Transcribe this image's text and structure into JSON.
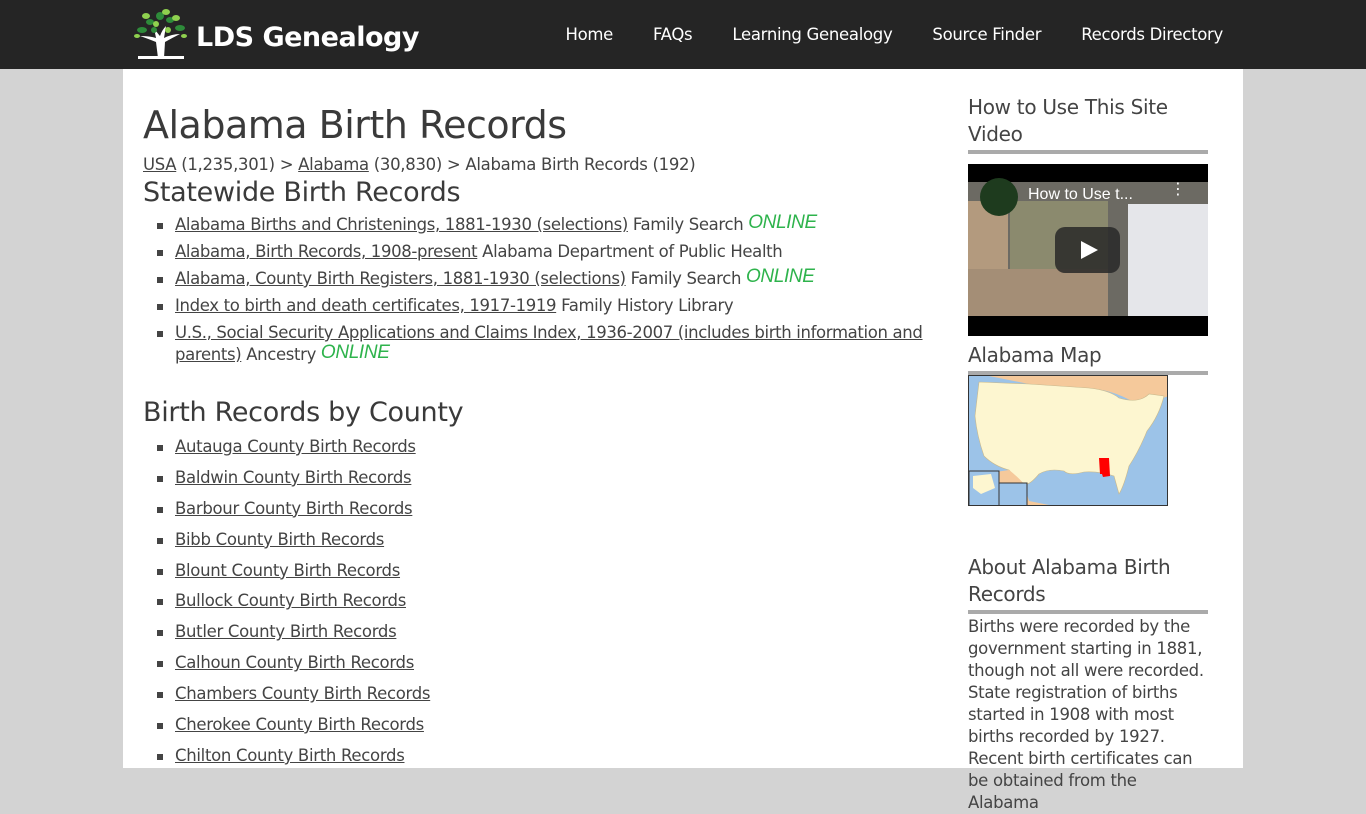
{
  "site": {
    "name": "LDS Genealogy",
    "logo_icon": "tree-icon"
  },
  "nav": [
    {
      "label": "Home"
    },
    {
      "label": "FAQs"
    },
    {
      "label": "Learning Genealogy"
    },
    {
      "label": "Source Finder"
    },
    {
      "label": "Records Directory"
    }
  ],
  "page": {
    "title": "Alabama Birth Records",
    "breadcrumb": {
      "usa_link": "USA",
      "usa_count": " (1,235,301) > ",
      "state_link": "Alabama",
      "state_count": " (30,830) > ",
      "current": "Alabama Birth Records (192)"
    }
  },
  "statewide": {
    "heading": "Statewide Birth Records",
    "items": [
      {
        "link": "Alabama Births and Christenings, 1881-1930 (selections)",
        "source": " Family Search ",
        "badge": "ONLINE"
      },
      {
        "link": "Alabama, Birth Records, 1908-present",
        "source": " Alabama Department of Public Health",
        "badge": ""
      },
      {
        "link": "Alabama, County Birth Registers, 1881-1930 (selections)",
        "source": " Family Search ",
        "badge": "ONLINE"
      },
      {
        "link": "Index to birth and death certificates, 1917-1919",
        "source": " Family History Library",
        "badge": ""
      },
      {
        "link": "U.S., Social Security Applications and Claims Index, 1936-2007 (includes birth information and parents)",
        "source": " Ancestry ",
        "badge": "ONLINE"
      }
    ]
  },
  "county": {
    "heading": "Birth Records by County",
    "items": [
      "Autauga County Birth Records",
      "Baldwin County Birth Records",
      "Barbour County Birth Records",
      "Bibb County Birth Records",
      "Blount County Birth Records",
      "Bullock County Birth Records",
      "Butler County Birth Records",
      "Calhoun County Birth Records",
      "Chambers County Birth Records",
      "Cherokee County Birth Records",
      "Chilton County Birth Records"
    ]
  },
  "sidebar": {
    "video_heading": "How to Use This Site Video",
    "video_title": "How to Use t...",
    "map_heading": "Alabama Map",
    "about_heading": "About Alabama Birth Records",
    "about_text": "Births were recorded by the government starting in 1881, though not all were recorded. State registration of births started in 1908 with most births recorded by 1927. Recent birth certificates can be obtained from the Alabama"
  },
  "colors": {
    "topbar": "#252525",
    "online": "#2eb34c",
    "highlight_state": "#ff0000",
    "background": "#d3d3d3"
  }
}
